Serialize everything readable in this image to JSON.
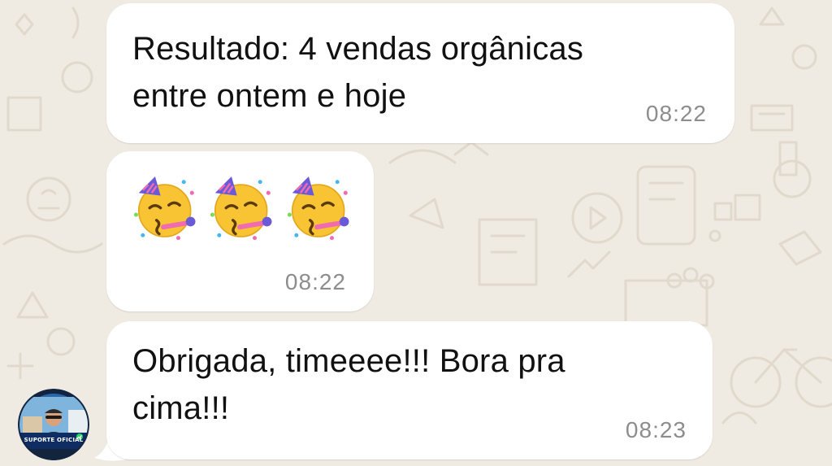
{
  "chat": {
    "messages": [
      {
        "lines": [
          "Resultado: 4 vendas orgânicas",
          "entre ontem e hoje"
        ],
        "time": "08:22"
      },
      {
        "emojis": [
          "partying-face",
          "partying-face",
          "partying-face"
        ],
        "time": "08:22"
      },
      {
        "lines": [
          "Obrigada, timeeee!!! Bora pra",
          "cima!!!"
        ],
        "time": "08:23"
      }
    ]
  },
  "sender": {
    "avatar_label": "SUPORTE OFICIAL",
    "avatar_badge_color": "#25d366"
  },
  "colors": {
    "wallpaper": "#efeae2",
    "bubble": "#ffffff",
    "text": "#111111",
    "timestamp": "#8d8d8d"
  }
}
